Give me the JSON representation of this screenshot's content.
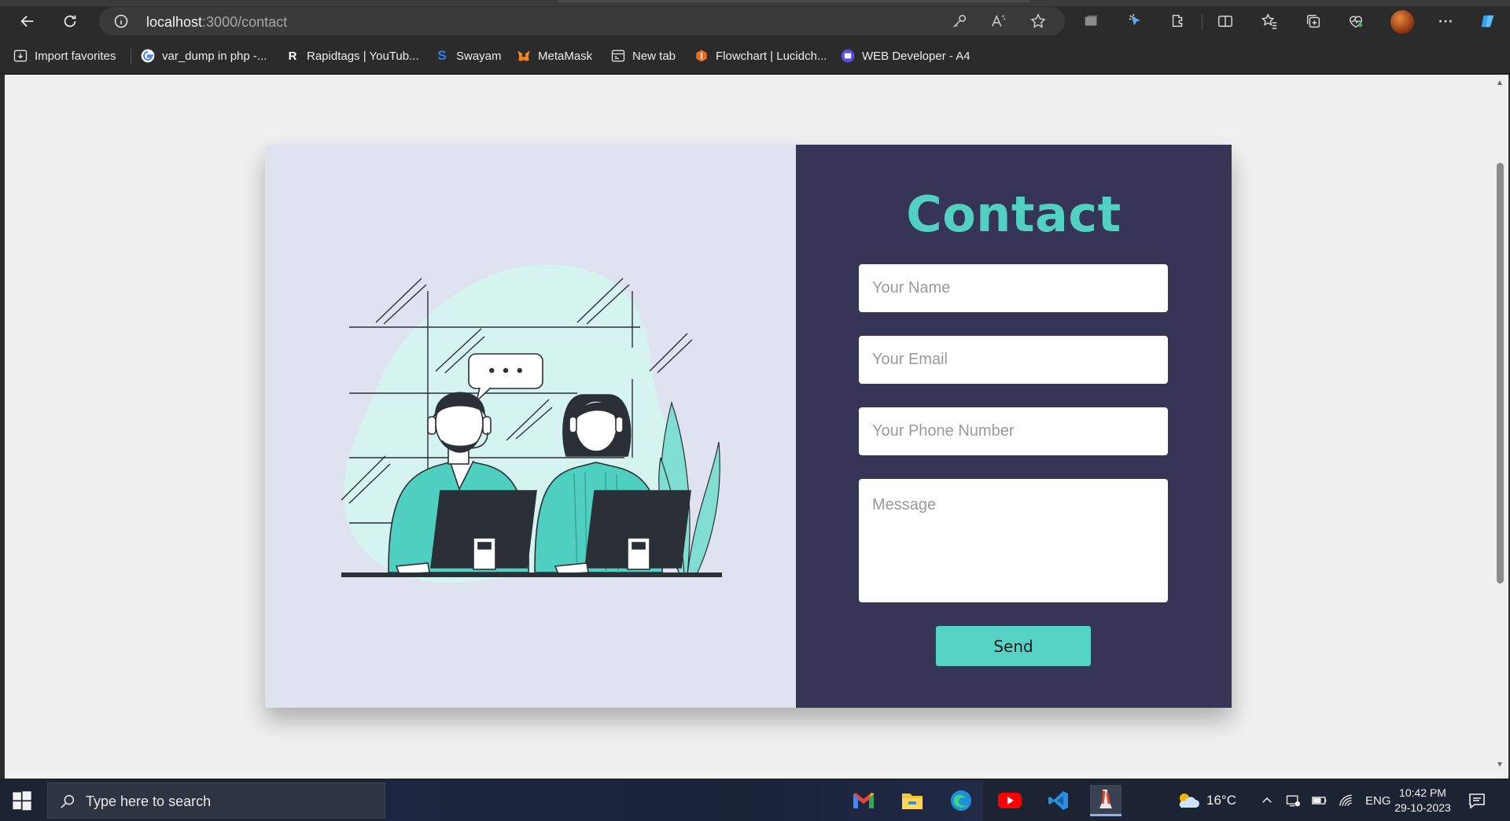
{
  "browser": {
    "url_host": "localhost",
    "url_path": ":3000/contact"
  },
  "bookmarks": [
    {
      "label": "Import favorites",
      "icon": "import-icon"
    },
    {
      "label": "var_dump in php -...",
      "icon": "google-icon"
    },
    {
      "label": "Rapidtags | YouTub...",
      "icon": "rapidtags-icon"
    },
    {
      "label": "Swayam",
      "icon": "swayam-icon"
    },
    {
      "label": "MetaMask",
      "icon": "metamask-icon"
    },
    {
      "label": "New tab",
      "icon": "newtab-icon"
    },
    {
      "label": "Flowchart | Lucidch...",
      "icon": "lucidchart-icon"
    },
    {
      "label": "WEB Developer - A4",
      "icon": "webdev-icon"
    }
  ],
  "contact": {
    "title": "Contact",
    "name_placeholder": "Your Name",
    "email_placeholder": "Your Email",
    "phone_placeholder": "Your Phone Number",
    "message_placeholder": "Message",
    "send_label": "Send"
  },
  "illustration": {
    "speech_bubble": "• • •"
  },
  "taskbar": {
    "search_placeholder": "Type here to search",
    "temperature": "16°C",
    "language": "ENG",
    "time": "10:42 PM",
    "date": "29-10-2023"
  },
  "colors": {
    "accent": "#52d1c3",
    "form_panel": "#363555",
    "illustration_panel": "#dfe3ef",
    "page_bg": "#f0f0f0"
  }
}
